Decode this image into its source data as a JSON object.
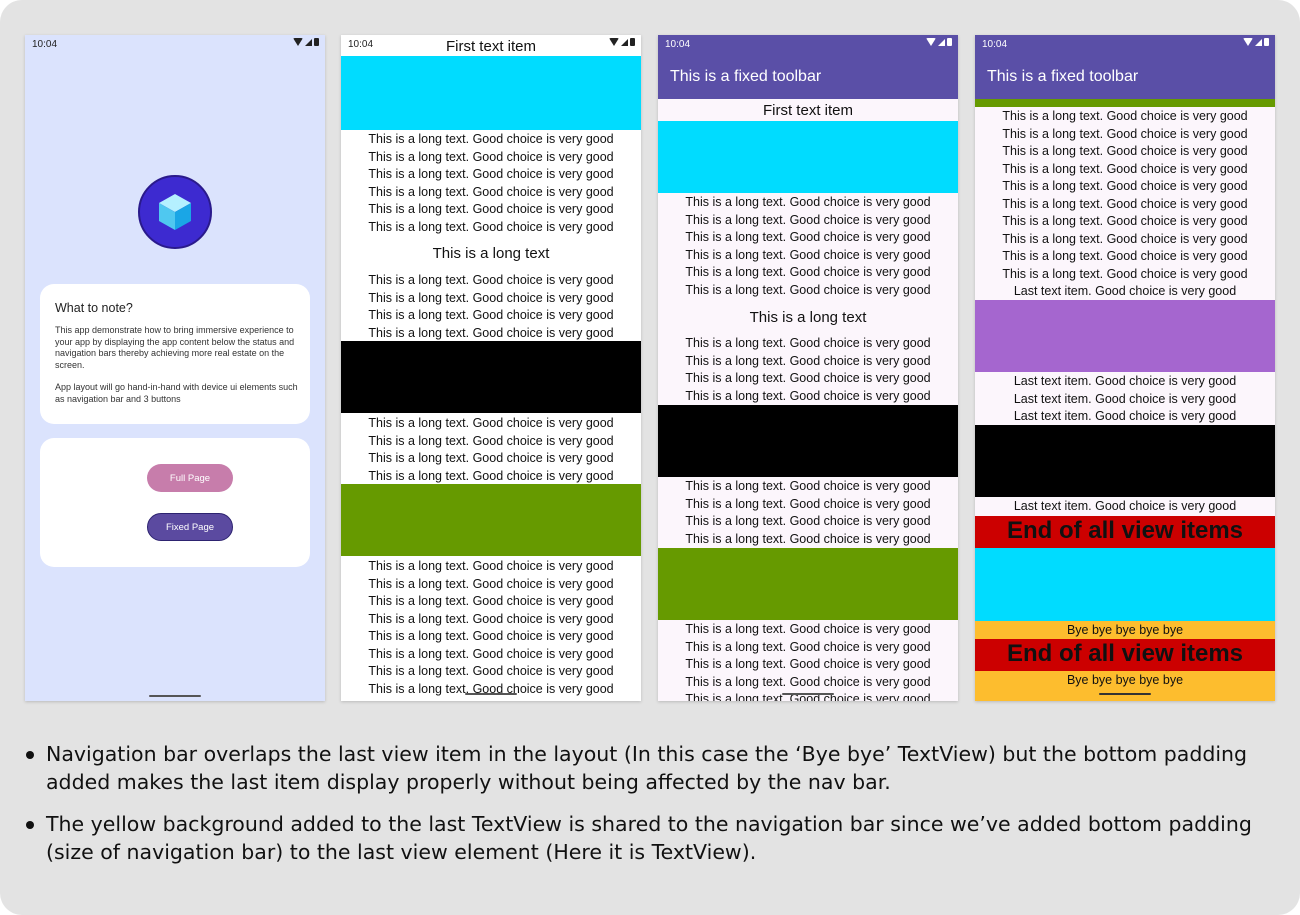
{
  "phone1": {
    "time": "10:04",
    "note_title": "What to note?",
    "note_para1": "This app demonstrate how to bring immersive experience to your app by displaying the app content below the status and navigation bars thereby achieving more real estate on the screen.",
    "note_para2": "App layout will go hand-in-hand with device ui elements such as navigation bar and 3 buttons",
    "full_page_label": "Full Page",
    "fixed_page_label": "Fixed Page",
    "logo_color": "#3d2ad0",
    "full_page_color": "#c77dab",
    "fixed_page_color": "#5b4aa0"
  },
  "phone2": {
    "time": "10:04",
    "first_item": "First text item",
    "heading": "This is a long text",
    "long_text": "This is a long text. Good choice is very good"
  },
  "phone3": {
    "time": "10:04",
    "toolbar_title": "This is a fixed toolbar",
    "first_item": "First text item",
    "heading": "This is a long text",
    "long_text": "This is a long text. Good choice is very good"
  },
  "phone4": {
    "time": "10:04",
    "toolbar_title": "This is a fixed toolbar",
    "long_text": "This is a long text. Good choice is very good",
    "last_text": "Last text item. Good choice is very good",
    "end_text": "End of all view items",
    "bye_text": "Bye bye bye bye bye"
  },
  "colors": {
    "cyan": "#00dcff",
    "black": "#000000",
    "green": "#669a00",
    "purple": "#a566cf",
    "red": "#cc0000",
    "yellow": "#fdbd2e",
    "toolbar": "#5a4fa7"
  },
  "notes": [
    "Navigation bar overlaps the last view item in the layout (In this case the ‘Bye bye’ TextView) but the bottom padding added makes the last item display properly without being affected by the nav bar.",
    "The yellow background added to the last TextView is shared to the navigation bar since we’ve added bottom padding (size of navigation bar) to the last view element (Here it is TextView)."
  ]
}
